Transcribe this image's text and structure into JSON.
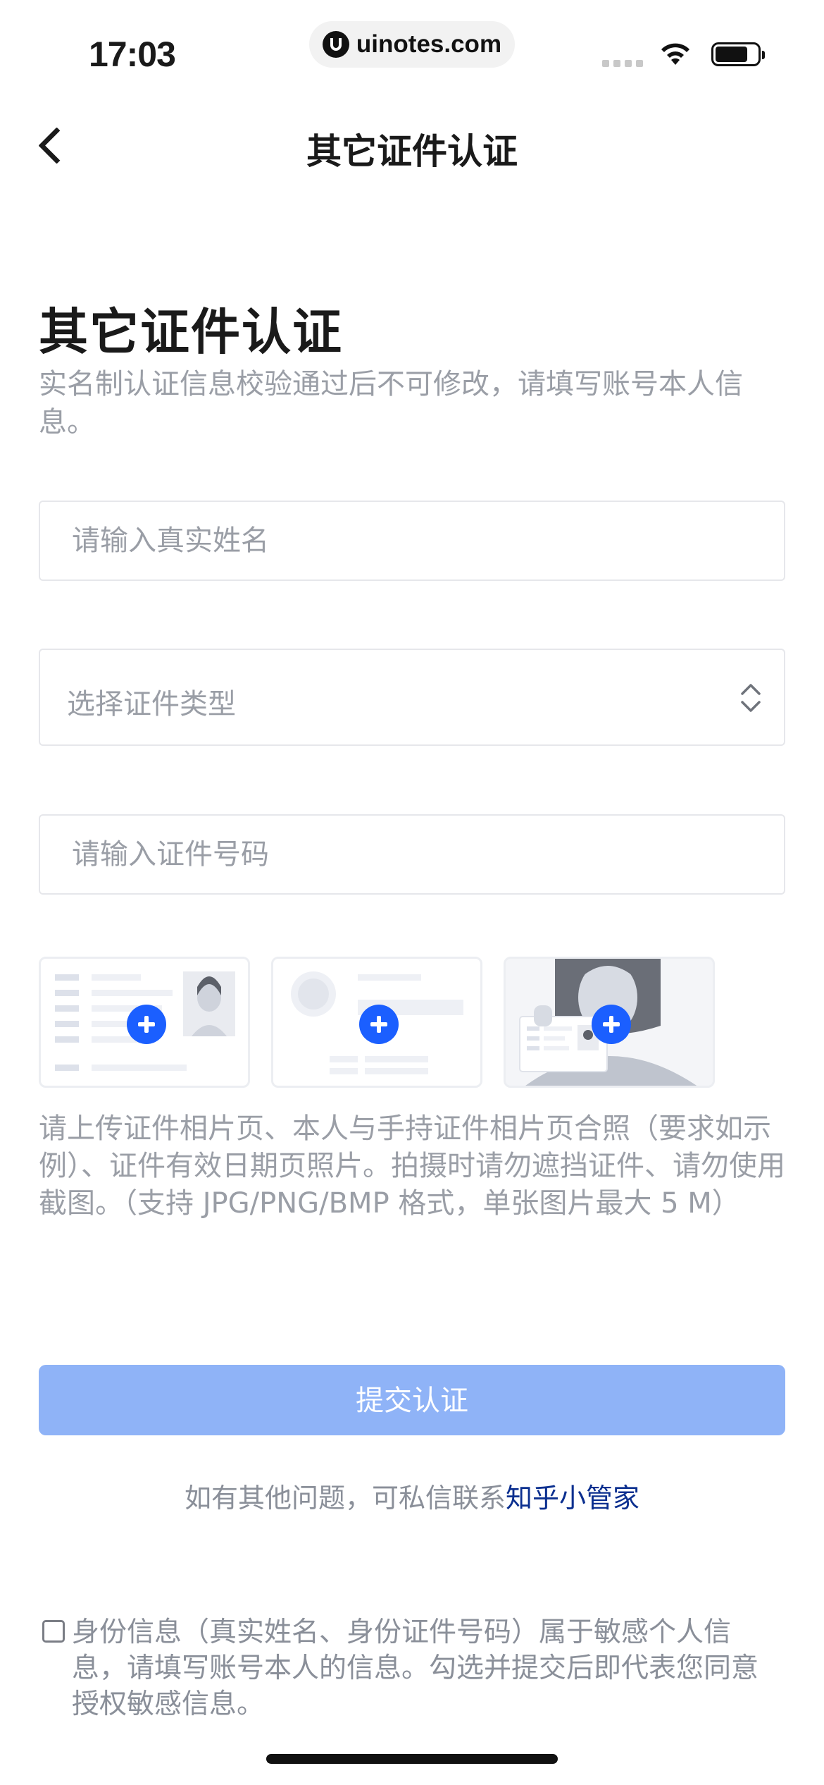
{
  "status_bar": {
    "time": "17:03",
    "url": "uinotes.com"
  },
  "nav": {
    "title": "其它证件认证"
  },
  "heading": {
    "title": "其它证件认证",
    "subtitle": "实名制认证信息校验通过后不可修改，请填写账号本人信息。"
  },
  "form": {
    "name_placeholder": "请输入真实姓名",
    "type_placeholder": "选择证件类型",
    "number_placeholder": "请输入证件号码"
  },
  "upload": {
    "hint": "请上传证件相片页、本人与手持证件相片页合照（要求如示例）、证件有效日期页照片。拍摄时请勿遮挡证件、请勿使用截图。（支持 JPG/PNG/BMP 格式，单张图片最大 5 M）"
  },
  "submit": {
    "label": "提交认证"
  },
  "help": {
    "prefix": "如有其他问题，可私信联系",
    "link": "知乎小管家"
  },
  "consent": {
    "text": "身份信息（真实姓名、身份证件号码）属于敏感个人信息，请填写账号本人的信息。勾选并提交后即代表您同意授权敏感信息。",
    "checked": false
  },
  "colors": {
    "accent": "#1b5fff",
    "submit_disabled": "#8fb3f7",
    "link": "#0b2f8f",
    "hint_text": "#9a9ea6"
  }
}
